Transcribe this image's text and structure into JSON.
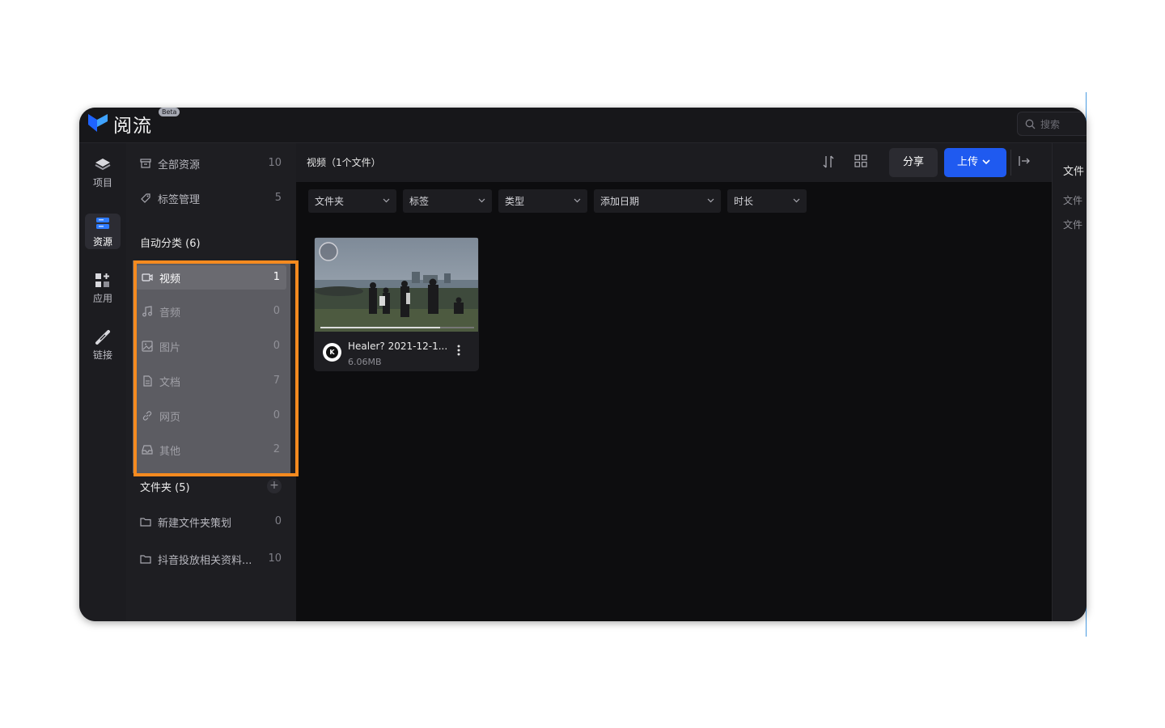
{
  "app": {
    "name": "阅流",
    "badge": "Beta"
  },
  "search": {
    "placeholder": "搜索"
  },
  "rail": [
    {
      "label": "项目"
    },
    {
      "label": "资源"
    },
    {
      "label": "应用"
    },
    {
      "label": "链接"
    }
  ],
  "sidebar": {
    "all": {
      "label": "全部资源",
      "count": "10"
    },
    "tags": {
      "label": "标签管理",
      "count": "5"
    },
    "auto_header": "自动分类 (6)",
    "categories": [
      {
        "label": "视频",
        "count": "1"
      },
      {
        "label": "音频",
        "count": "0"
      },
      {
        "label": "图片",
        "count": "0"
      },
      {
        "label": "文档",
        "count": "7"
      },
      {
        "label": "网页",
        "count": "0"
      },
      {
        "label": "其他",
        "count": "2"
      }
    ],
    "folder_header": "文件夹 (5)",
    "folder_add": "+",
    "folders": [
      {
        "label": "新建文件夹策划",
        "count": "0"
      },
      {
        "label": "抖音投放相关资料...",
        "count": "10"
      }
    ]
  },
  "main": {
    "title": "视频（1个文件）",
    "share_label": "分享",
    "upload_label": "上传",
    "filters": [
      "文件夹",
      "标签",
      "类型",
      "添加日期",
      "时长"
    ],
    "files": [
      {
        "name": "Healer? 2021-12-1...",
        "size": "6.06MB",
        "avatar_letter": "K"
      }
    ]
  },
  "right_panel": {
    "title": "文件",
    "line1": "文件",
    "line2": "文件"
  },
  "colors": {
    "accent": "#1f5af0",
    "highlight": "#f58a1f",
    "background": "#1c1c20"
  }
}
